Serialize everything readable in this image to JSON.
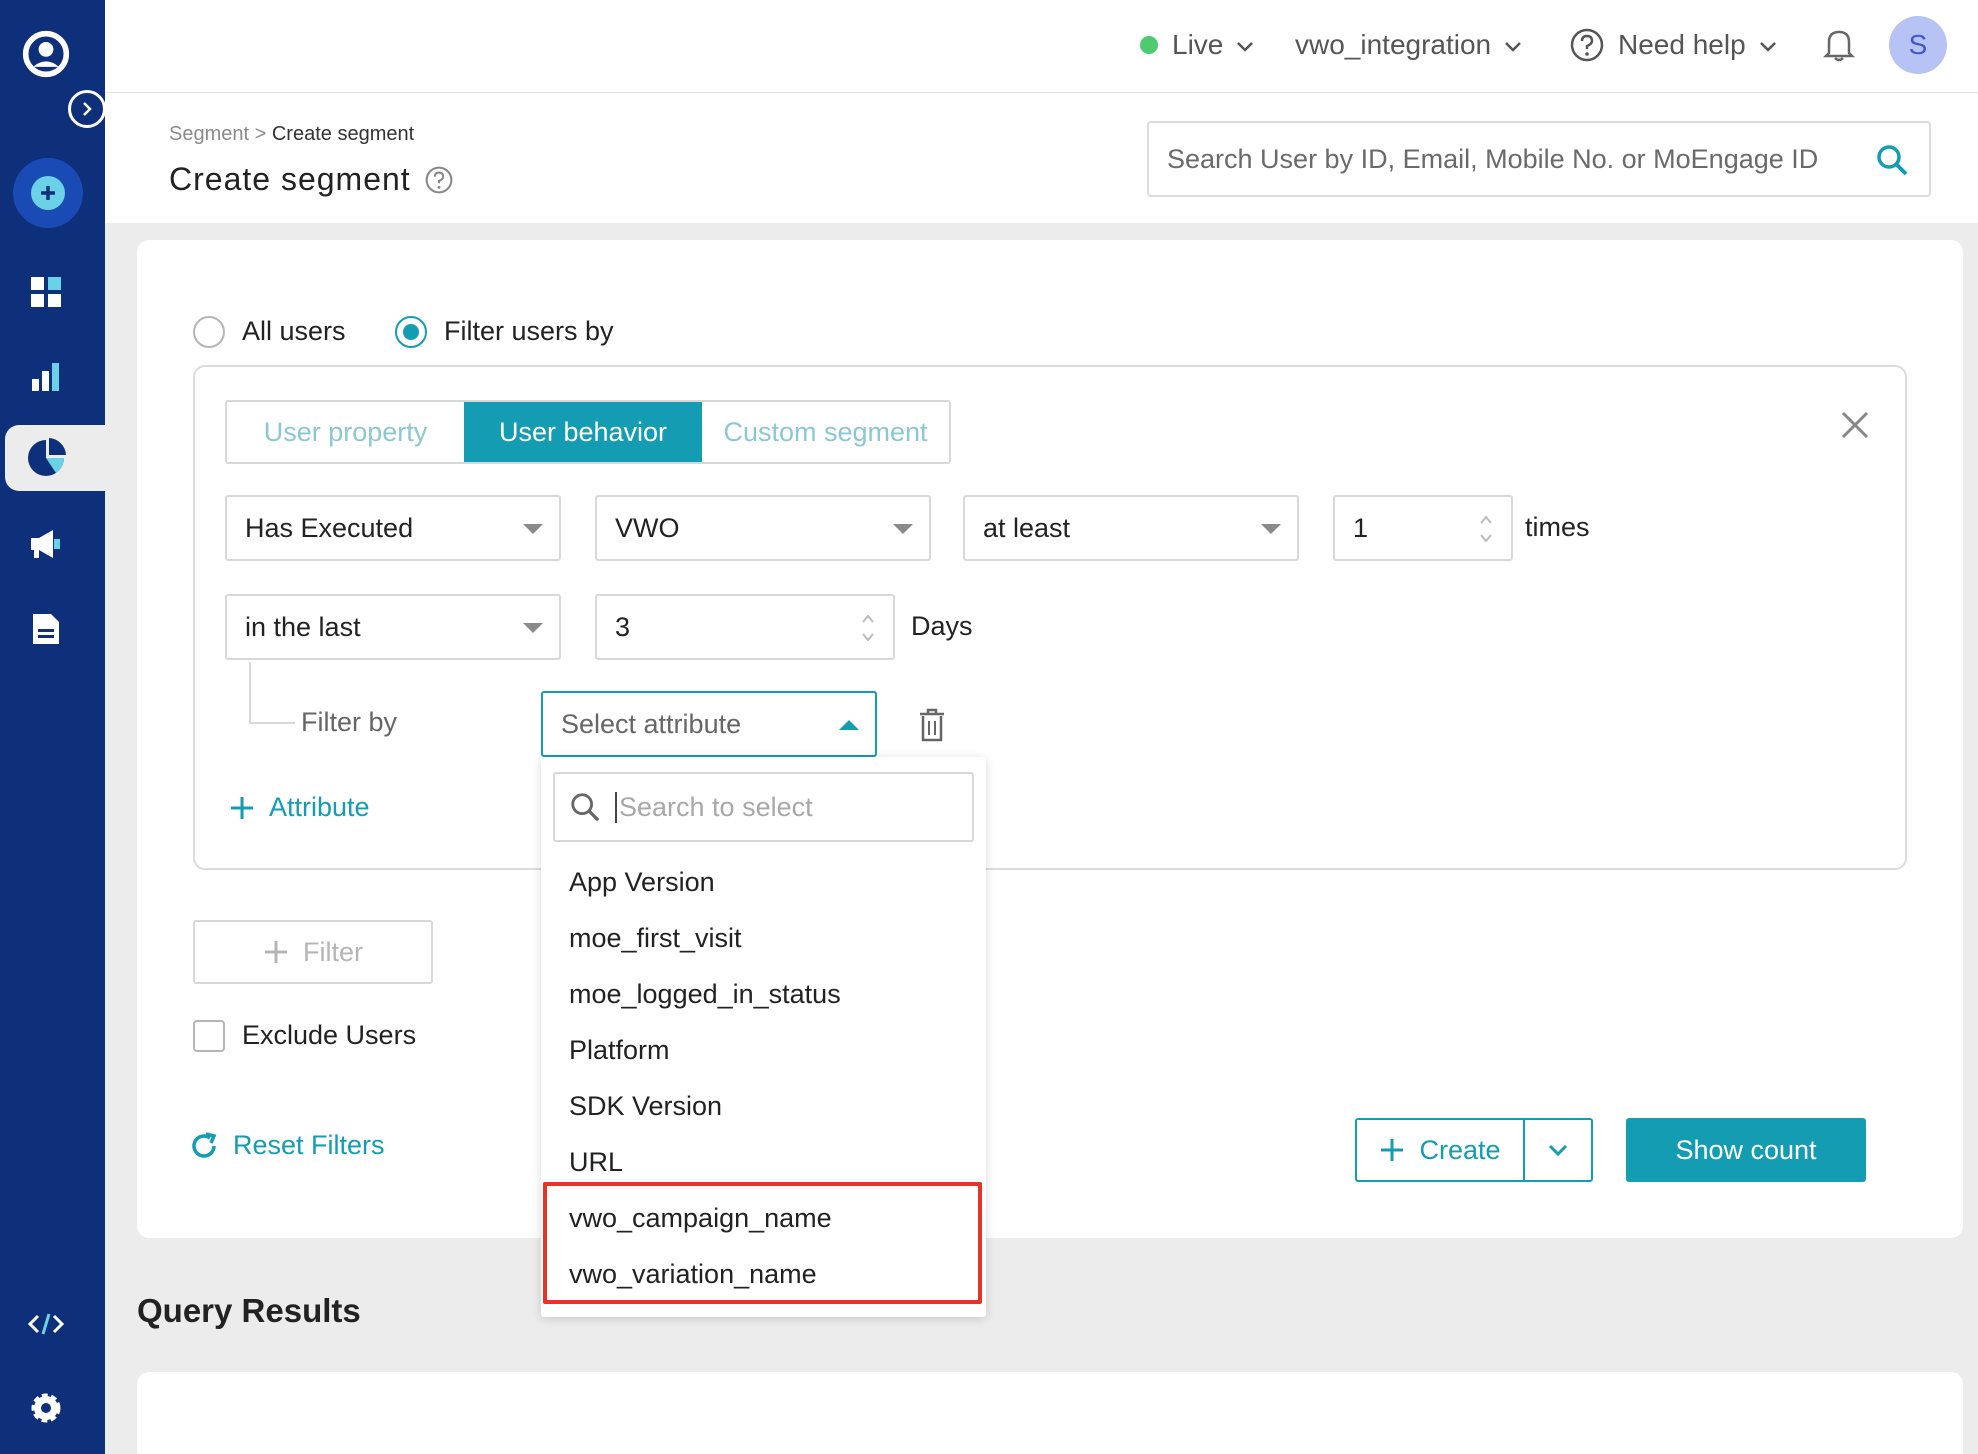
{
  "header": {
    "env_label": "Live",
    "workspace": "vwo_integration",
    "help_label": "Need help",
    "avatar_initial": "S"
  },
  "page": {
    "breadcrumb_parent": "Segment >",
    "breadcrumb_current": "Create segment",
    "title": "Create segment",
    "search_placeholder": "Search User by ID, Email, Mobile No. or MoEngage ID"
  },
  "audience": {
    "all_users_label": "All users",
    "filter_users_label": "Filter users by",
    "selected": "filter"
  },
  "tabs": [
    {
      "label": "User property",
      "active": false
    },
    {
      "label": "User behavior",
      "active": true
    },
    {
      "label": "Custom segment",
      "active": false
    }
  ],
  "condition": {
    "action": "Has Executed",
    "event": "VWO",
    "frequency": "at least",
    "count": "1",
    "count_unit": "times",
    "time_window": "in the last",
    "days": "3",
    "days_unit": "Days",
    "filter_by_label": "Filter by",
    "attribute_placeholder": "Select attribute",
    "add_attribute_label": "Attribute"
  },
  "actions": {
    "add_filter_label": "Filter",
    "exclude_users_label": "Exclude Users",
    "reset_filters_label": "Reset Filters",
    "create_label": "Create",
    "show_count_label": "Show count"
  },
  "query_results_title": "Query Results",
  "dropdown": {
    "search_placeholder": "Search to select",
    "options": [
      "App Version",
      "moe_first_visit",
      "moe_logged_in_status",
      "Platform",
      "SDK Version",
      "URL",
      "vwo_campaign_name",
      "vwo_variation_name"
    ]
  },
  "colors": {
    "sidebar": "#0e2f7a",
    "accent": "#149cb2",
    "live_dot": "#4ecb71",
    "highlight": "#e53428"
  }
}
